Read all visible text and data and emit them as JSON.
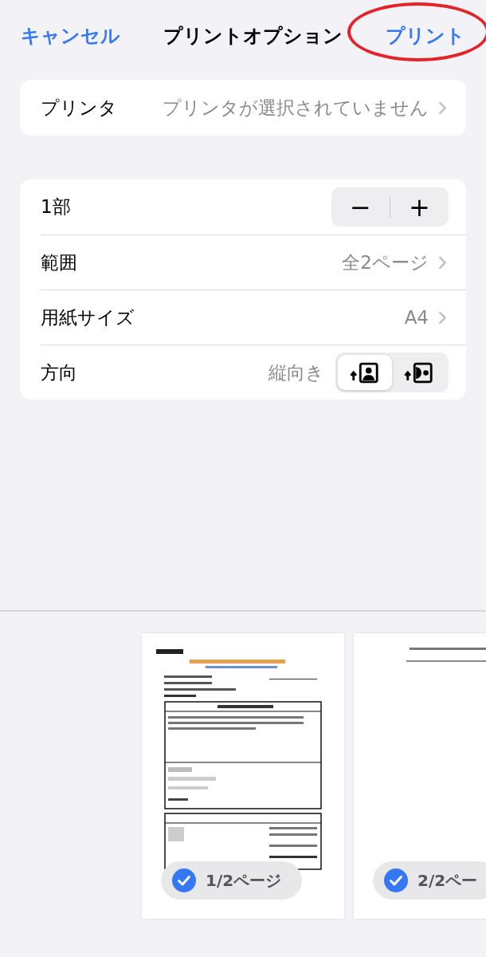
{
  "nav": {
    "cancel": "キャンセル",
    "title": "プリントオプション",
    "print": "プリント",
    "print_circled": true
  },
  "printer": {
    "label": "プリンタ",
    "value": "プリンタが選択されていません"
  },
  "options": [
    {
      "kind": "stepper",
      "label": "1部",
      "decrement": "−",
      "increment": "+"
    },
    {
      "kind": "link",
      "label": "範囲",
      "value": "全2ページ"
    },
    {
      "kind": "link",
      "label": "用紙サイズ",
      "value": "A4"
    },
    {
      "kind": "orientation",
      "label": "方向",
      "value": "縦向き",
      "segments": [
        {
          "kind": "portrait",
          "selected": true
        },
        {
          "kind": "landscape",
          "selected": false
        }
      ]
    }
  ],
  "pages": [
    {
      "kind": "full",
      "label": "1/2ページ",
      "checked": true
    },
    {
      "kind": "short",
      "label": "2/2ペー",
      "checked": true
    }
  ]
}
